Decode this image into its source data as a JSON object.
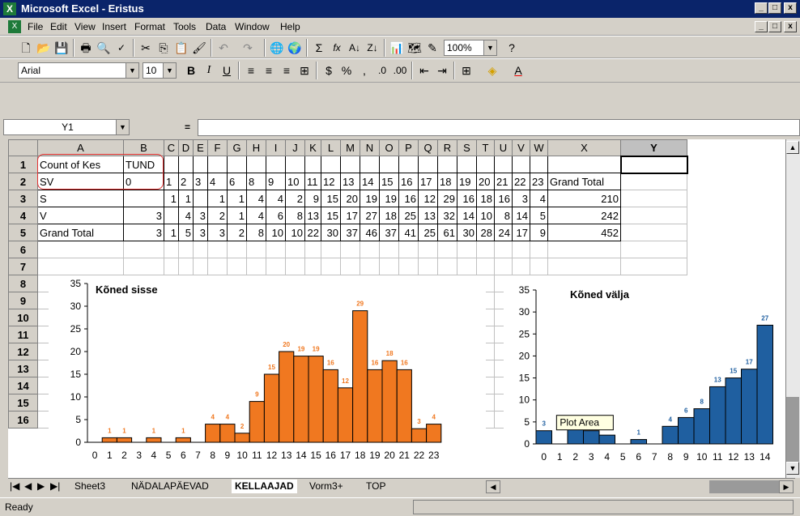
{
  "window": {
    "title": "Microsoft Excel - Eristus"
  },
  "menu": [
    "File",
    "Edit",
    "View",
    "Insert",
    "Format",
    "Tools",
    "Data",
    "Window",
    "Help"
  ],
  "toolbar": {
    "zoom": "100%"
  },
  "format_toolbar": {
    "font": "Arial",
    "size": "10"
  },
  "formula_bar": {
    "name_box": "Y1",
    "eq": "="
  },
  "columns": [
    "A",
    "B",
    "C",
    "D",
    "E",
    "F",
    "G",
    "H",
    "I",
    "J",
    "K",
    "L",
    "M",
    "N",
    "O",
    "P",
    "Q",
    "R",
    "S",
    "T",
    "U",
    "V",
    "W",
    "X",
    "Y"
  ],
  "rows": [
    {
      "n": "1",
      "cells": [
        "Count of Kes",
        "TUND",
        "",
        "",
        "",
        "",
        "",
        "",
        "",
        "",
        "",
        "",
        "",
        "",
        "",
        "",
        "",
        "",
        "",
        "",
        "",
        "",
        "",
        "",
        ""
      ]
    },
    {
      "n": "2",
      "cells": [
        "SV",
        "0",
        "1",
        "2",
        "3",
        "4",
        "6",
        "8",
        "9",
        "10",
        "11",
        "12",
        "13",
        "14",
        "15",
        "16",
        "17",
        "18",
        "19",
        "20",
        "21",
        "22",
        "23",
        "Grand Total",
        ""
      ]
    },
    {
      "n": "3",
      "cells": [
        "S",
        "",
        "1",
        "1",
        "",
        "1",
        "1",
        "4",
        "4",
        "2",
        "9",
        "15",
        "20",
        "19",
        "19",
        "16",
        "12",
        "29",
        "16",
        "18",
        "16",
        "3",
        "4",
        "210",
        ""
      ]
    },
    {
      "n": "4",
      "cells": [
        "V",
        "3",
        "",
        "4",
        "3",
        "2",
        "1",
        "4",
        "6",
        "8",
        "13",
        "15",
        "17",
        "27",
        "18",
        "25",
        "13",
        "32",
        "14",
        "10",
        "8",
        "14",
        "5",
        "242",
        ""
      ]
    },
    {
      "n": "5",
      "cells": [
        "Grand Total",
        "3",
        "1",
        "5",
        "3",
        "3",
        "2",
        "8",
        "10",
        "10",
        "22",
        "30",
        "37",
        "46",
        "37",
        "41",
        "25",
        "61",
        "30",
        "28",
        "24",
        "17",
        "9",
        "452",
        ""
      ]
    },
    {
      "n": "6",
      "cells": []
    },
    {
      "n": "7",
      "cells": []
    },
    {
      "n": "8",
      "cells": []
    },
    {
      "n": "9",
      "cells": []
    },
    {
      "n": "10",
      "cells": []
    },
    {
      "n": "11",
      "cells": []
    },
    {
      "n": "12",
      "cells": []
    },
    {
      "n": "13",
      "cells": []
    },
    {
      "n": "14",
      "cells": []
    },
    {
      "n": "15",
      "cells": []
    },
    {
      "n": "16",
      "cells": []
    }
  ],
  "chart_data": [
    {
      "type": "bar",
      "title": "Kõned sisse",
      "color": "#f07820",
      "categories": [
        "0",
        "1",
        "2",
        "3",
        "4",
        "5",
        "6",
        "7",
        "8",
        "9",
        "10",
        "11",
        "12",
        "13",
        "14",
        "15",
        "16",
        "17",
        "18",
        "19",
        "20",
        "21",
        "22",
        "23"
      ],
      "values": [
        0,
        1,
        1,
        0,
        1,
        0,
        1,
        0,
        4,
        4,
        2,
        9,
        15,
        20,
        19,
        19,
        16,
        12,
        29,
        16,
        18,
        16,
        3,
        4
      ],
      "ylim": [
        0,
        35
      ],
      "yticks": [
        "0",
        "5",
        "10",
        "15",
        "20",
        "25",
        "30",
        "35"
      ]
    },
    {
      "type": "bar",
      "title": "Kõned välja",
      "color": "#1f5fa0",
      "categories": [
        "0",
        "1",
        "2",
        "3",
        "4",
        "5",
        "6",
        "7",
        "8",
        "9",
        "10",
        "11",
        "12",
        "13",
        "14"
      ],
      "values": [
        3,
        0,
        4,
        3,
        2,
        0,
        1,
        0,
        4,
        6,
        8,
        13,
        15,
        17,
        27
      ],
      "ylim": [
        0,
        35
      ],
      "yticks": [
        "0",
        "5",
        "10",
        "15",
        "20",
        "25",
        "30",
        "35"
      ],
      "tooltip": "Plot Area"
    }
  ],
  "sheet_tabs": [
    "Sheet3",
    "NÄDALAPÄEVAD",
    "KELLAAJAD",
    "Vorm3+",
    "TOP"
  ],
  "active_tab": "KELLAAJAD",
  "status": "Ready"
}
